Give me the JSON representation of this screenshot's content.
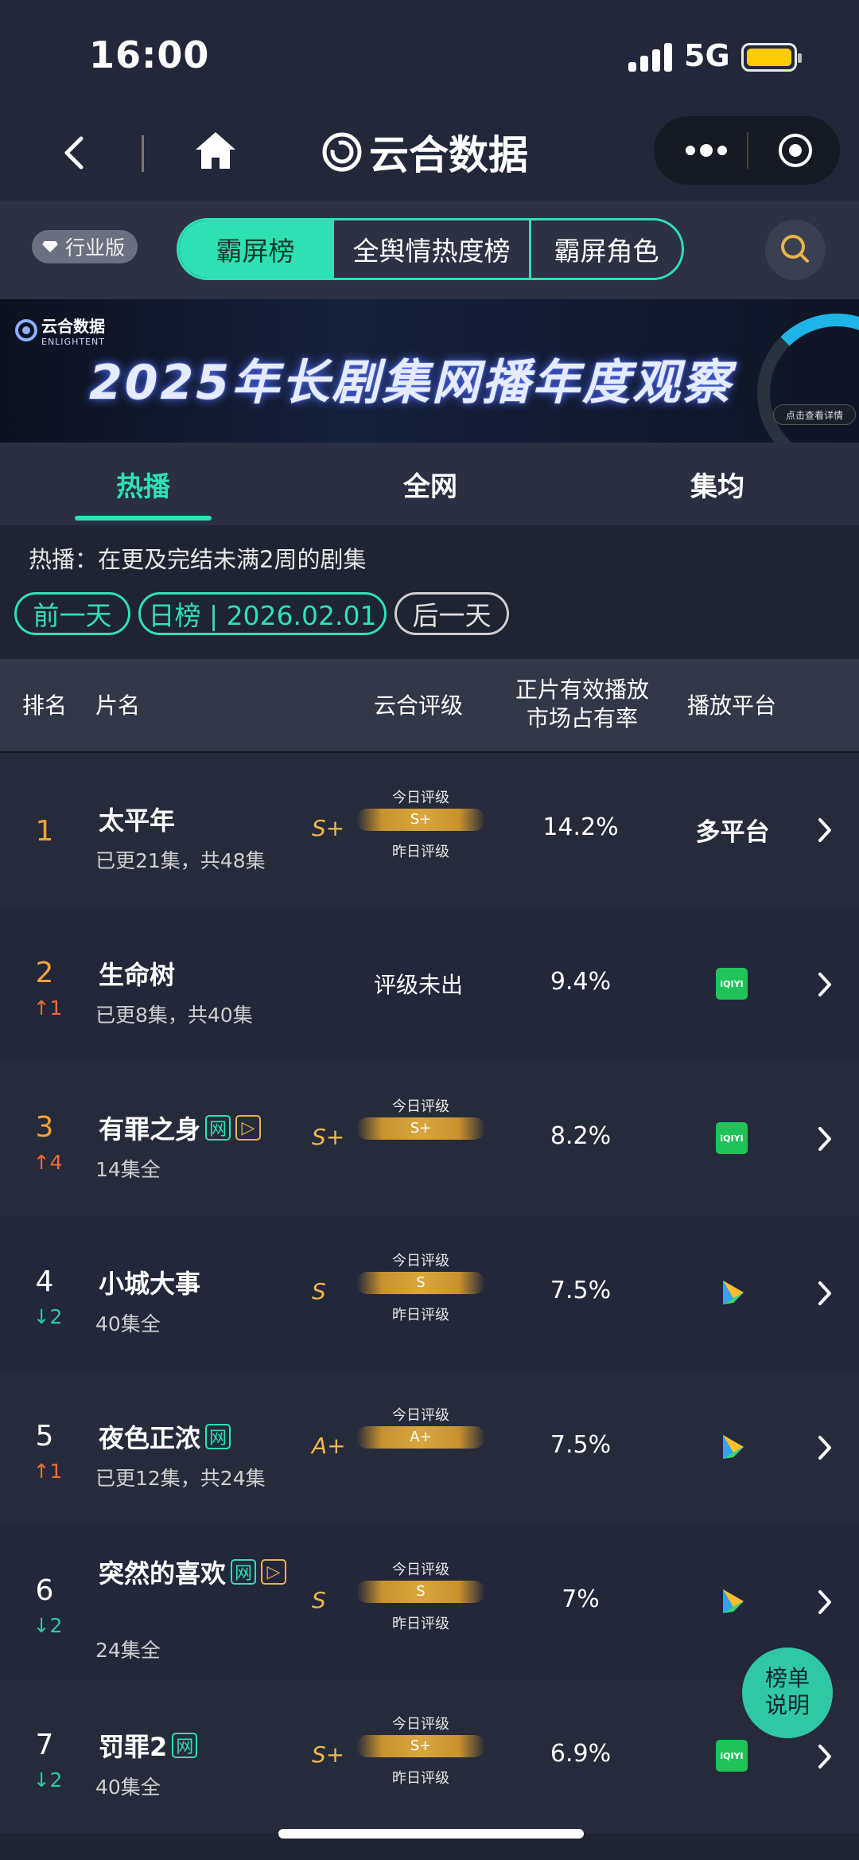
{
  "status_bar": {
    "time": "16:00",
    "network": "5G"
  },
  "nav": {
    "brand": "云合数据"
  },
  "top_tabs": {
    "badge": "行业版",
    "items": [
      "霸屏榜",
      "全舆情热度榜",
      "霸屏角色"
    ]
  },
  "banner": {
    "logo_cn": "云合数据",
    "logo_en": "ENLIGHTENT",
    "title": "2025年长剧集网播年度观察",
    "detail": "点击查看详情"
  },
  "category_tabs": [
    "热播",
    "全网",
    "集均"
  ],
  "info": {
    "description": "热播：在更及完结未满2周的剧集",
    "prev_day": "前一天",
    "date_label": "日榜 | 2026.02.01",
    "next_day": "后一天"
  },
  "table_header": {
    "rank": "排名",
    "title": "片名",
    "rating": "云合评级",
    "share_line1": "正片有效播放",
    "share_line2": "市场占有率",
    "platform": "播放平台"
  },
  "rows": [
    {
      "rank": "1",
      "change": "",
      "change_dir": "none",
      "title": "太平年",
      "tags": [],
      "sub": "已更21集，共48集",
      "grade": "S+",
      "today_label": "今日评级",
      "bar": "S+",
      "yesterday_label": "昨日评级",
      "share": "14.2%",
      "platform": "多平台",
      "platform_icon": "text",
      "rank_color": "#f2a33a"
    },
    {
      "rank": "2",
      "change": "↑1",
      "change_dir": "up",
      "title": "生命树",
      "tags": [],
      "sub": "已更8集，共40集",
      "no_rating": "评级未出",
      "share": "9.4%",
      "platform_icon": "iqiyi-icon",
      "rank_color": "#f2a33a"
    },
    {
      "rank": "3",
      "change": "↑4",
      "change_dir": "up",
      "title": "有罪之身",
      "tags": [
        "网",
        "▷"
      ],
      "sub": "14集全",
      "grade": "S+",
      "today_label": "今日评级",
      "bar": "S+",
      "yesterday_label": "",
      "share": "8.2%",
      "platform_icon": "iqiyi-icon",
      "rank_color": "#f2a33a"
    },
    {
      "rank": "4",
      "change": "↓2",
      "change_dir": "down",
      "title": "小城大事",
      "tags": [],
      "sub": "40集全",
      "grade": "S",
      "today_label": "今日评级",
      "bar": "S",
      "yesterday_label": "昨日评级",
      "share": "7.5%",
      "platform_icon": "tencent-video-icon",
      "rank_color": "#ffffff"
    },
    {
      "rank": "5",
      "change": "↑1",
      "change_dir": "up",
      "title": "夜色正浓",
      "tags": [
        "网"
      ],
      "sub": "已更12集，共24集",
      "grade": "A+",
      "today_label": "今日评级",
      "bar": "A+",
      "yesterday_label": "",
      "share": "7.5%",
      "platform_icon": "tencent-video-icon",
      "rank_color": "#ffffff"
    },
    {
      "rank": "6",
      "change": "↓2",
      "change_dir": "down",
      "title": "突然的喜欢",
      "tags": [
        "网",
        "▷"
      ],
      "sub": "24集全",
      "grade": "S",
      "today_label": "今日评级",
      "bar": "S",
      "yesterday_label": "昨日评级",
      "share": "7%",
      "platform_icon": "tencent-video-icon",
      "rank_color": "#ffffff"
    },
    {
      "rank": "7",
      "change": "↓2",
      "change_dir": "down",
      "title": "罚罪2",
      "tags": [
        "网"
      ],
      "sub": "40集全",
      "grade": "S+",
      "today_label": "今日评级",
      "bar": "S+",
      "yesterday_label": "昨日评级",
      "share": "6.9%",
      "platform_icon": "iqiyi-icon",
      "rank_color": "#ffffff"
    }
  ],
  "iqiyi_text": "iQIYI",
  "help": {
    "line1": "榜单",
    "line2": "说明"
  },
  "colors": {
    "accent": "#2fe0b3",
    "up": "#f26a3b",
    "down": "#2fc8a2",
    "gold": "#f0b84a"
  }
}
